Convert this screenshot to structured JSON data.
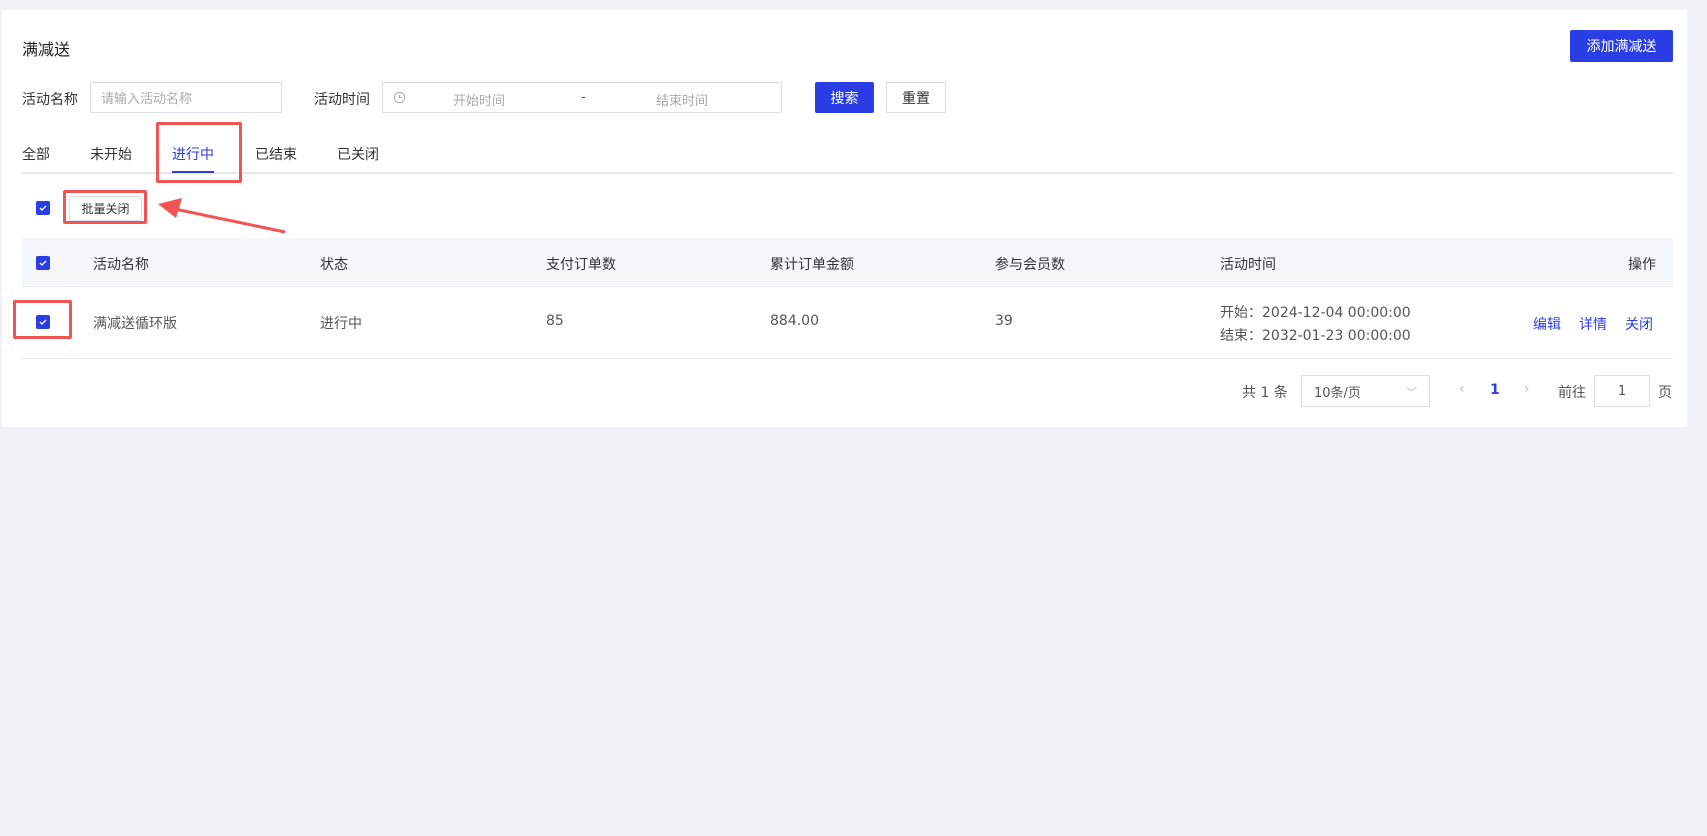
{
  "page": {
    "title": "满减送",
    "add_button": "添加满减送"
  },
  "filters": {
    "name_label": "活动名称",
    "name_placeholder": "请输入活动名称",
    "time_label": "活动时间",
    "start_placeholder": "开始时间",
    "separator": "-",
    "end_placeholder": "结束时间",
    "search": "搜索",
    "reset": "重置"
  },
  "tabs": [
    {
      "label": "全部"
    },
    {
      "label": "未开始"
    },
    {
      "label": "进行中"
    },
    {
      "label": "已结束"
    },
    {
      "label": "已关闭"
    }
  ],
  "batch": {
    "close_label": "批量关闭"
  },
  "table": {
    "headers": [
      "活动名称",
      "状态",
      "支付订单数",
      "累计订单金额",
      "参与会员数",
      "活动时间",
      "操作"
    ],
    "rows": [
      {
        "name": "满减送循环版",
        "status": "进行中",
        "paid_orders": "85",
        "total_amount": "884.00",
        "members": "39",
        "start": "开始：2024-12-04 00:00:00",
        "end": "结束：2032-01-23 00:00:00",
        "actions": [
          "编辑",
          "详情",
          "关闭"
        ]
      }
    ]
  },
  "pagination": {
    "total": "共 1 条",
    "page_size": "10条/页",
    "current": "1",
    "goto_label": "前往",
    "goto_value": "1",
    "page_suffix": "页"
  },
  "colors": {
    "primary": "#2b3ee6",
    "annotation": "#f25454"
  }
}
